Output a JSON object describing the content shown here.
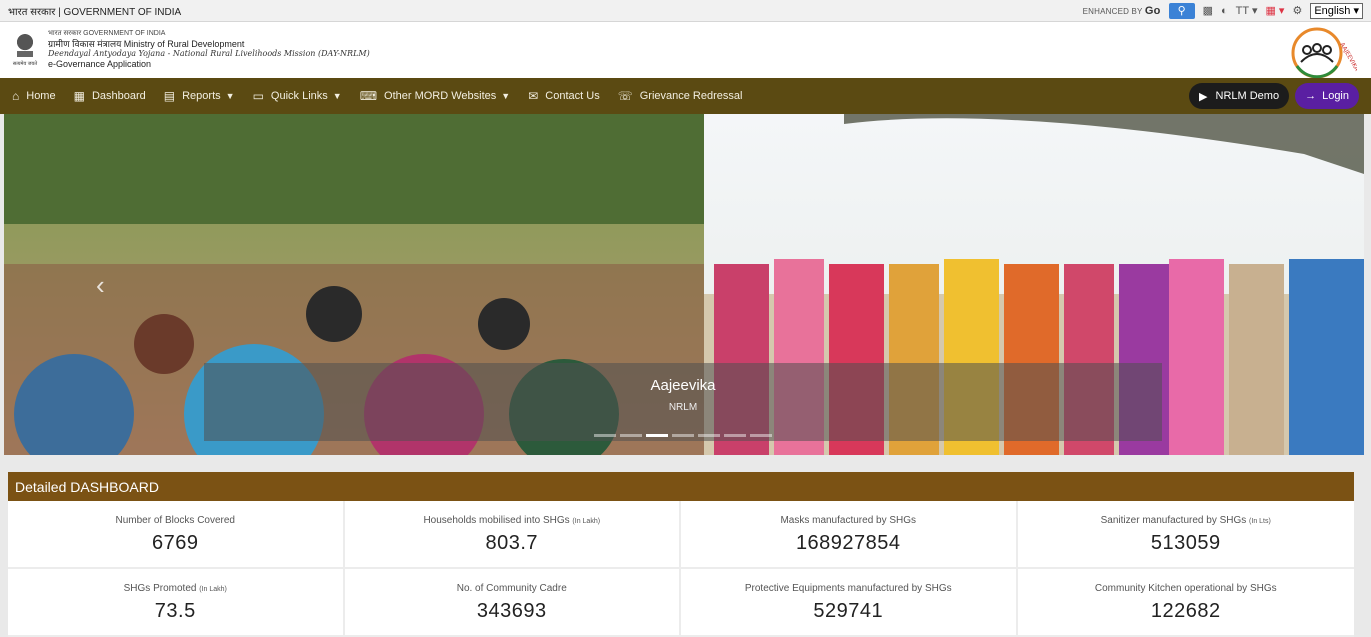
{
  "topbar": {
    "gov_text": "भारत सरकार | GOVERNMENT OF INDIA",
    "enhanced_by": "ENHANCED BY",
    "enhanced_brand": "Go",
    "text_size_label": "TT",
    "language": "English"
  },
  "header": {
    "hindi_gov": "भारत सरकार   GOVERNMENT OF INDIA",
    "ministry": "ग्रामीण विकास मंत्रालय  Ministry of Rural Development",
    "mission": "Deendayal Antyodaya Yojana - National Rural Livelihoods Mission (DAY-NRLM)",
    "app": "e-Governance Application",
    "emblem_motto": "सत्यमेव जयते",
    "logo_text": "AAJEEVIKA"
  },
  "nav": {
    "items": [
      {
        "label": "Home",
        "icon": "home-icon",
        "caret": false
      },
      {
        "label": "Dashboard",
        "icon": "dashboard-icon",
        "caret": false
      },
      {
        "label": "Reports",
        "icon": "reports-icon",
        "caret": true
      },
      {
        "label": "Quick Links",
        "icon": "quick-links-icon",
        "caret": true
      },
      {
        "label": "Other MORD Websites",
        "icon": "websites-icon",
        "caret": true
      },
      {
        "label": "Contact Us",
        "icon": "contact-icon",
        "caret": false
      },
      {
        "label": "Grievance Redressal",
        "icon": "grievance-icon",
        "caret": false
      }
    ],
    "demo_label": "NRLM Demo",
    "login_label": "Login"
  },
  "banner": {
    "title": "Aajeevika",
    "subtitle": "NRLM",
    "slide_count": 7,
    "active_slide": 3
  },
  "dashboard": {
    "title": "Detailed DASHBOARD",
    "stats": [
      {
        "label": "Number of Blocks Covered",
        "unit": "",
        "value": "6769"
      },
      {
        "label": "Households mobilised into SHGs",
        "unit": "(In Lakh)",
        "value": "803.7"
      },
      {
        "label": "Masks manufactured by SHGs",
        "unit": "",
        "value": "168927854"
      },
      {
        "label": "Sanitizer manufactured by SHGs",
        "unit": "(In Lts)",
        "value": "513059"
      },
      {
        "label": "SHGs Promoted",
        "unit": "(In Lakh)",
        "value": "73.5"
      },
      {
        "label": "No. of Community Cadre",
        "unit": "",
        "value": "343693"
      },
      {
        "label": "Protective Equipments manufactured by SHGs",
        "unit": "",
        "value": "529741"
      },
      {
        "label": "Community Kitchen operational by SHGs",
        "unit": "",
        "value": "122682"
      }
    ]
  },
  "colors": {
    "nav_bg": "#5b4a12",
    "dash_header": "#7b5214",
    "login_bg": "#5a1fa2",
    "demo_bg": "#1c1c1c"
  }
}
